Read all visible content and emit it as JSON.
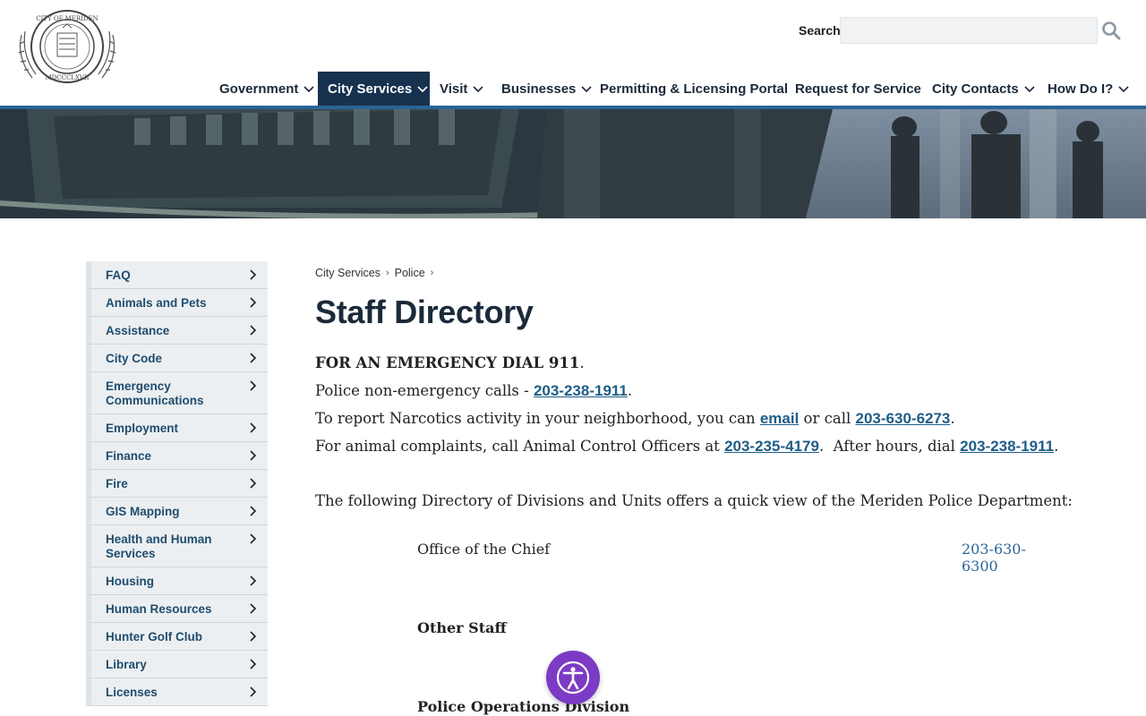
{
  "header": {
    "logo_text_top": "CITY OF MERIDEN",
    "logo_text_bottom": "MDCCCLXVII",
    "search_label": "Search",
    "search_placeholder": "",
    "search_value": ""
  },
  "nav": {
    "items": [
      {
        "label": "Government",
        "has_dropdown": true,
        "active": false
      },
      {
        "label": "City Services",
        "has_dropdown": true,
        "active": true
      },
      {
        "label": "Visit",
        "has_dropdown": true,
        "active": false
      },
      {
        "label": "Businesses",
        "has_dropdown": true,
        "active": false
      },
      {
        "label": "Permitting & Licensing Portal",
        "has_dropdown": false,
        "active": false
      },
      {
        "label": "Request for Service",
        "has_dropdown": false,
        "active": false
      },
      {
        "label": "City Contacts",
        "has_dropdown": true,
        "active": false
      },
      {
        "label": "How Do I?",
        "has_dropdown": true,
        "active": false
      }
    ]
  },
  "sidebar": {
    "items": [
      {
        "label": "FAQ"
      },
      {
        "label": "Animals and Pets"
      },
      {
        "label": "Assistance"
      },
      {
        "label": "City Code"
      },
      {
        "label": "Emergency Communications"
      },
      {
        "label": "Employment"
      },
      {
        "label": "Finance"
      },
      {
        "label": "Fire"
      },
      {
        "label": "GIS Mapping"
      },
      {
        "label": "Health and Human Services"
      },
      {
        "label": "Housing"
      },
      {
        "label": "Human Resources"
      },
      {
        "label": "Hunter Golf Club"
      },
      {
        "label": "Library"
      },
      {
        "label": "Licenses"
      }
    ]
  },
  "breadcrumb": {
    "items": [
      "City Services",
      "Police"
    ],
    "separator": "›"
  },
  "main": {
    "title": "Staff Directory",
    "emergency": "FOR AN EMERGENCY DIAL 911",
    "emergency_suffix": ".",
    "line2_prefix": "Police non-emergency calls - ",
    "line2_phone": "203-238-1911",
    "line2_suffix": ".",
    "line3_prefix": "To report Narcotics activity in your neighborhood, you can ",
    "line3_link": "email",
    "line3_mid": " or call ",
    "line3_phone": "203-630-6273",
    "line3_suffix": ".",
    "line4_prefix": "For animal complaints, call Animal Control Officers at ",
    "line4_phone1": "203-235-4179",
    "line4_mid": ".  After hours, dial ",
    "line4_phone2": "203-238-1911",
    "line4_suffix": ".",
    "intro": "The following Directory of Divisions and Units offers a quick view of the Meriden Police Department:",
    "directory": [
      {
        "name": "Office of the Chief",
        "phone": "203-630-6300"
      }
    ],
    "section_other": "Other Staff",
    "section_ops": "Police Operations Division"
  },
  "colors": {
    "nav_active_bg": "#16324f",
    "accent_rule": "#2a6496",
    "link": "#1f5d87",
    "sidebar_text": "#1f4d6e",
    "a11y_button": "#7b3bc4"
  },
  "icons": {
    "search": "search-icon",
    "dropdown": "chevron-down-icon",
    "sidebar_arrow": "chevron-right-icon",
    "accessibility": "accessibility-icon"
  }
}
